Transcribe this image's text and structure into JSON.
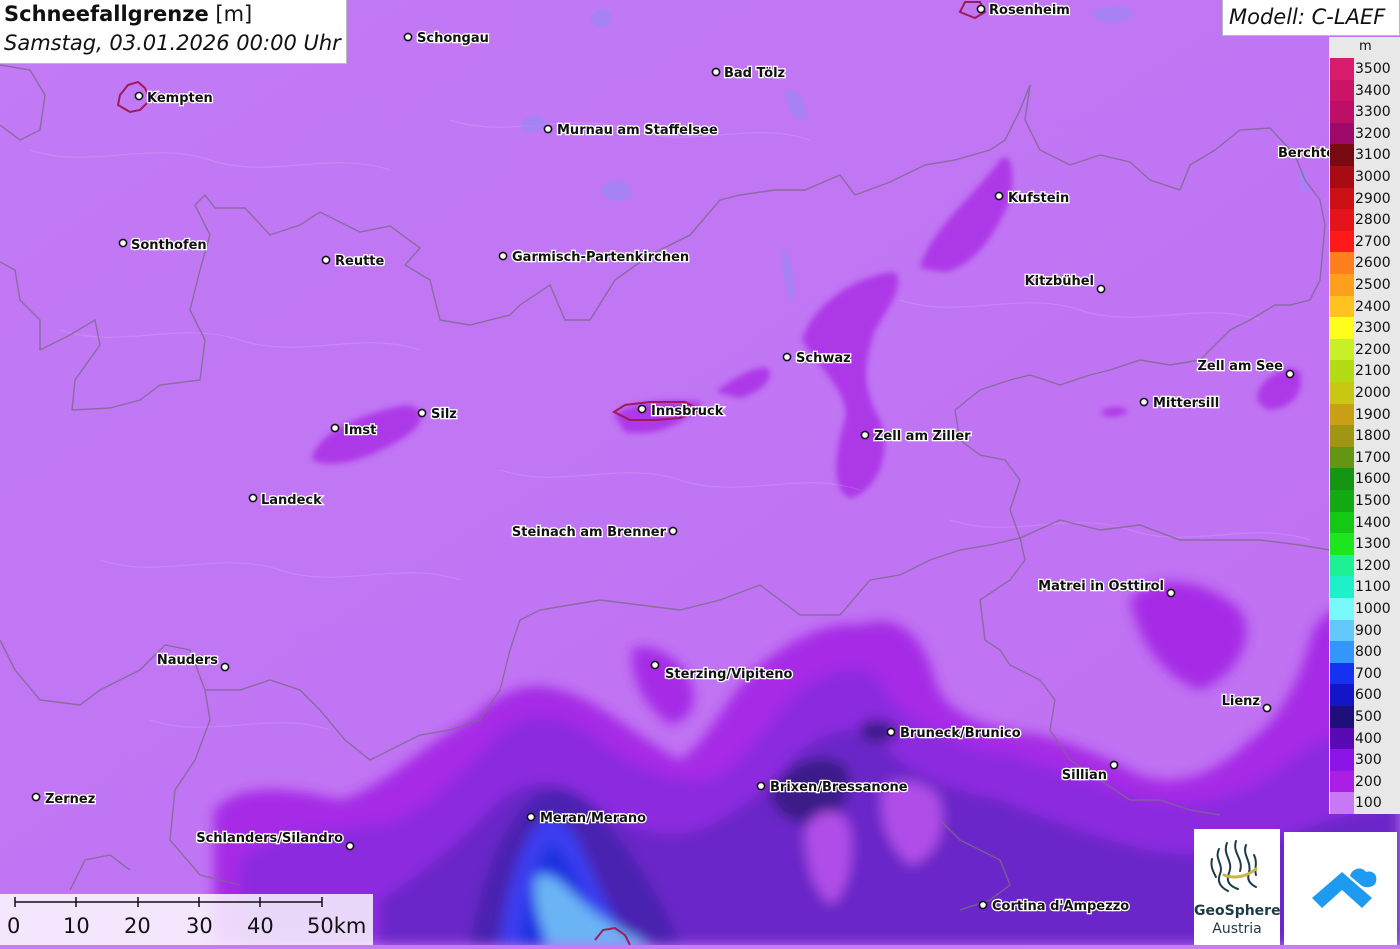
{
  "header": {
    "title_bold": "Schneefallgrenze",
    "title_unit": " [m]",
    "datetime": "Samstag, 03.01.2026 00:00 Uhr",
    "model": "Modell: C-LAEF"
  },
  "legend": {
    "unit": "m",
    "levels": [
      {
        "label": "3500",
        "color": "#d81b6a"
      },
      {
        "label": "3400",
        "color": "#cc1467"
      },
      {
        "label": "3300",
        "color": "#be0f66"
      },
      {
        "label": "3200",
        "color": "#9e0a6a"
      },
      {
        "label": "3100",
        "color": "#7a0a12"
      },
      {
        "label": "3000",
        "color": "#a80c12"
      },
      {
        "label": "2900",
        "color": "#cc1016"
      },
      {
        "label": "2800",
        "color": "#e5141a"
      },
      {
        "label": "2700",
        "color": "#ff1a1a"
      },
      {
        "label": "2600",
        "color": "#ff7f1e"
      },
      {
        "label": "2500",
        "color": "#ff9f1e"
      },
      {
        "label": "2400",
        "color": "#ffc21e"
      },
      {
        "label": "2300",
        "color": "#ffff1e"
      },
      {
        "label": "2200",
        "color": "#c8ef28"
      },
      {
        "label": "2100",
        "color": "#b4dc14"
      },
      {
        "label": "2000",
        "color": "#c8c814"
      },
      {
        "label": "1900",
        "color": "#c8a014"
      },
      {
        "label": "1800",
        "color": "#a09614"
      },
      {
        "label": "1700",
        "color": "#649614"
      },
      {
        "label": "1600",
        "color": "#149614"
      },
      {
        "label": "1500",
        "color": "#14aa14"
      },
      {
        "label": "1400",
        "color": "#14c814"
      },
      {
        "label": "1300",
        "color": "#1ee61e"
      },
      {
        "label": "1200",
        "color": "#1ef096"
      },
      {
        "label": "1100",
        "color": "#1ef0c8"
      },
      {
        "label": "1000",
        "color": "#78fafa"
      },
      {
        "label": "900",
        "color": "#64c8fa"
      },
      {
        "label": "800",
        "color": "#3296fa"
      },
      {
        "label": "700",
        "color": "#1432f0"
      },
      {
        "label": "600",
        "color": "#1414c8"
      },
      {
        "label": "500",
        "color": "#1e0f78"
      },
      {
        "label": "400",
        "color": "#5a0ab4"
      },
      {
        "label": "300",
        "color": "#8c14e6"
      },
      {
        "label": "200",
        "color": "#aa1ee6"
      },
      {
        "label": "100",
        "color": "#c878f5"
      }
    ]
  },
  "cities": [
    {
      "name": "Rosenheim",
      "anchor": "start"
    },
    {
      "name": "Schongau",
      "anchor": "start"
    },
    {
      "name": "Bad Tölz",
      "anchor": "start"
    },
    {
      "name": "Kempten",
      "anchor": "start"
    },
    {
      "name": "Murnau am Staffelsee",
      "anchor": "start"
    },
    {
      "name": "Berchte",
      "anchor": "start"
    },
    {
      "name": "Kufstein",
      "anchor": "start"
    },
    {
      "name": "Sonthofen",
      "anchor": "start"
    },
    {
      "name": "Reutte",
      "anchor": "start"
    },
    {
      "name": "Garmisch-Partenkirchen",
      "anchor": "start"
    },
    {
      "name": "Kitzbühel",
      "anchor": "end"
    },
    {
      "name": "Schwaz",
      "anchor": "start"
    },
    {
      "name": "Zell am See",
      "anchor": "end"
    },
    {
      "name": "Mittersill",
      "anchor": "start"
    },
    {
      "name": "Innsbruck",
      "anchor": "start"
    },
    {
      "name": "Silz",
      "anchor": "start"
    },
    {
      "name": "Imst",
      "anchor": "start"
    },
    {
      "name": "Zell am Ziller",
      "anchor": "start"
    },
    {
      "name": "Landeck",
      "anchor": "start"
    },
    {
      "name": "Steinach am Brenner",
      "anchor": "end"
    },
    {
      "name": "Matrei in Osttirol",
      "anchor": "end"
    },
    {
      "name": "Nauders",
      "anchor": "end"
    },
    {
      "name": "Sterzing/Vipiteno",
      "anchor": "start"
    },
    {
      "name": "Lienz",
      "anchor": "end"
    },
    {
      "name": "Bruneck/Brunico",
      "anchor": "start"
    },
    {
      "name": "Sillian",
      "anchor": "end"
    },
    {
      "name": "Brixen/Bressanone",
      "anchor": "start"
    },
    {
      "name": "Zernez",
      "anchor": "start"
    },
    {
      "name": "Meran/Merano",
      "anchor": "start"
    },
    {
      "name": "Schlanders/Silandro",
      "anchor": "end"
    },
    {
      "name": "Cortina d'Ampezzo",
      "anchor": "start"
    }
  ],
  "scalebar": {
    "ticks": [
      "0",
      "10",
      "20",
      "30",
      "40",
      "50km"
    ]
  },
  "logos": {
    "geosphere_name": "GeoSphere",
    "geosphere_sub": "Austria"
  }
}
